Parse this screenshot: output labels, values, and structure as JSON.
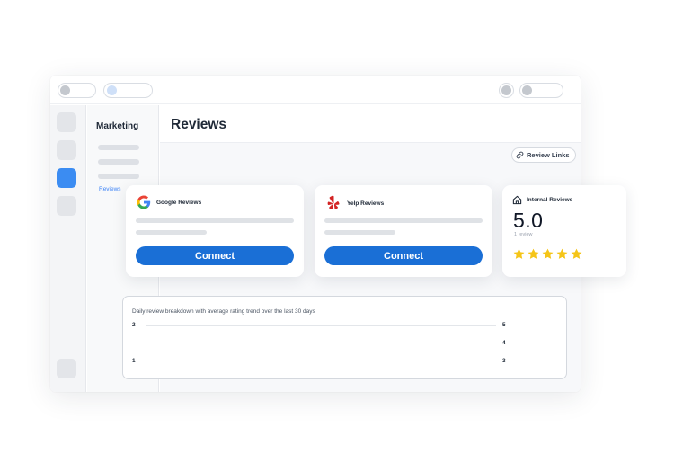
{
  "sidebar": {
    "section_title": "Marketing",
    "active_item": "Reviews"
  },
  "header": {
    "title": "Reviews",
    "review_links_label": "Review Links"
  },
  "cards": {
    "google": {
      "title": "Google Reviews",
      "button": "Connect",
      "icon": "google-logo-icon"
    },
    "yelp": {
      "title": "Yelp Reviews",
      "button": "Connect",
      "icon": "yelp-logo-icon"
    },
    "internal": {
      "title": "Internal Reviews",
      "rating": "5.0",
      "count": "1 review",
      "stars": 5,
      "icon": "home-icon"
    }
  },
  "chart": {
    "caption": "Daily review breakdown with average rating trend over the last 30 days",
    "left_ticks": [
      "2",
      "1"
    ],
    "right_ticks": [
      "5",
      "4",
      "3"
    ]
  },
  "colors": {
    "accent": "#1a6fd6",
    "rail_active": "#3b8cf2",
    "star": "#f5c518",
    "yelp_red": "#d32323"
  }
}
